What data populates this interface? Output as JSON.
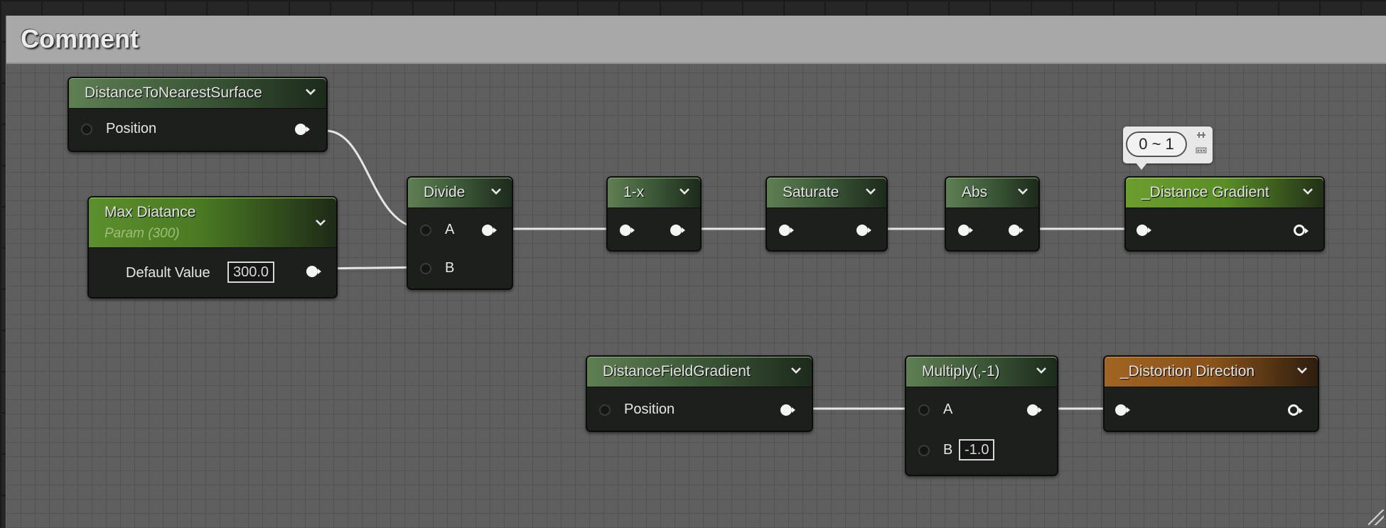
{
  "comment": {
    "title": "Comment"
  },
  "tooltip": {
    "text": "0 ~ 1"
  },
  "nodes": {
    "distance_to_nearest_surface": {
      "title": "DistanceToNearestSurface",
      "inputs": [
        "Position"
      ]
    },
    "max_distance": {
      "title": "Max Diatance",
      "subtitle": "Param (300)",
      "default_label": "Default Value",
      "default_value": "300.0"
    },
    "divide": {
      "title": "Divide",
      "inputs": [
        "A",
        "B"
      ]
    },
    "one_minus_x": {
      "title": "1-x"
    },
    "saturate": {
      "title": "Saturate"
    },
    "abs": {
      "title": "Abs"
    },
    "distance_gradient": {
      "title": "_Distance Gradient"
    },
    "distance_field_gradient": {
      "title": "DistanceFieldGradient",
      "inputs": [
        "Position"
      ]
    },
    "multiply": {
      "title": "Multiply(,-1)",
      "inputs": [
        "A",
        "B"
      ],
      "b_value": "-1.0"
    },
    "distortion_direction": {
      "title": "_Distortion Direction"
    }
  },
  "colors": {
    "param_header": "#5c8f2c",
    "function_header": "#5f7f53",
    "output_header": "#6c9e2e",
    "vector_output_header": "#a16422",
    "wire": "#e8e8e8"
  },
  "icons": [
    "chevron-down-icon",
    "pin-icon",
    "more-dots-icon",
    "resize-grip-icon"
  ]
}
